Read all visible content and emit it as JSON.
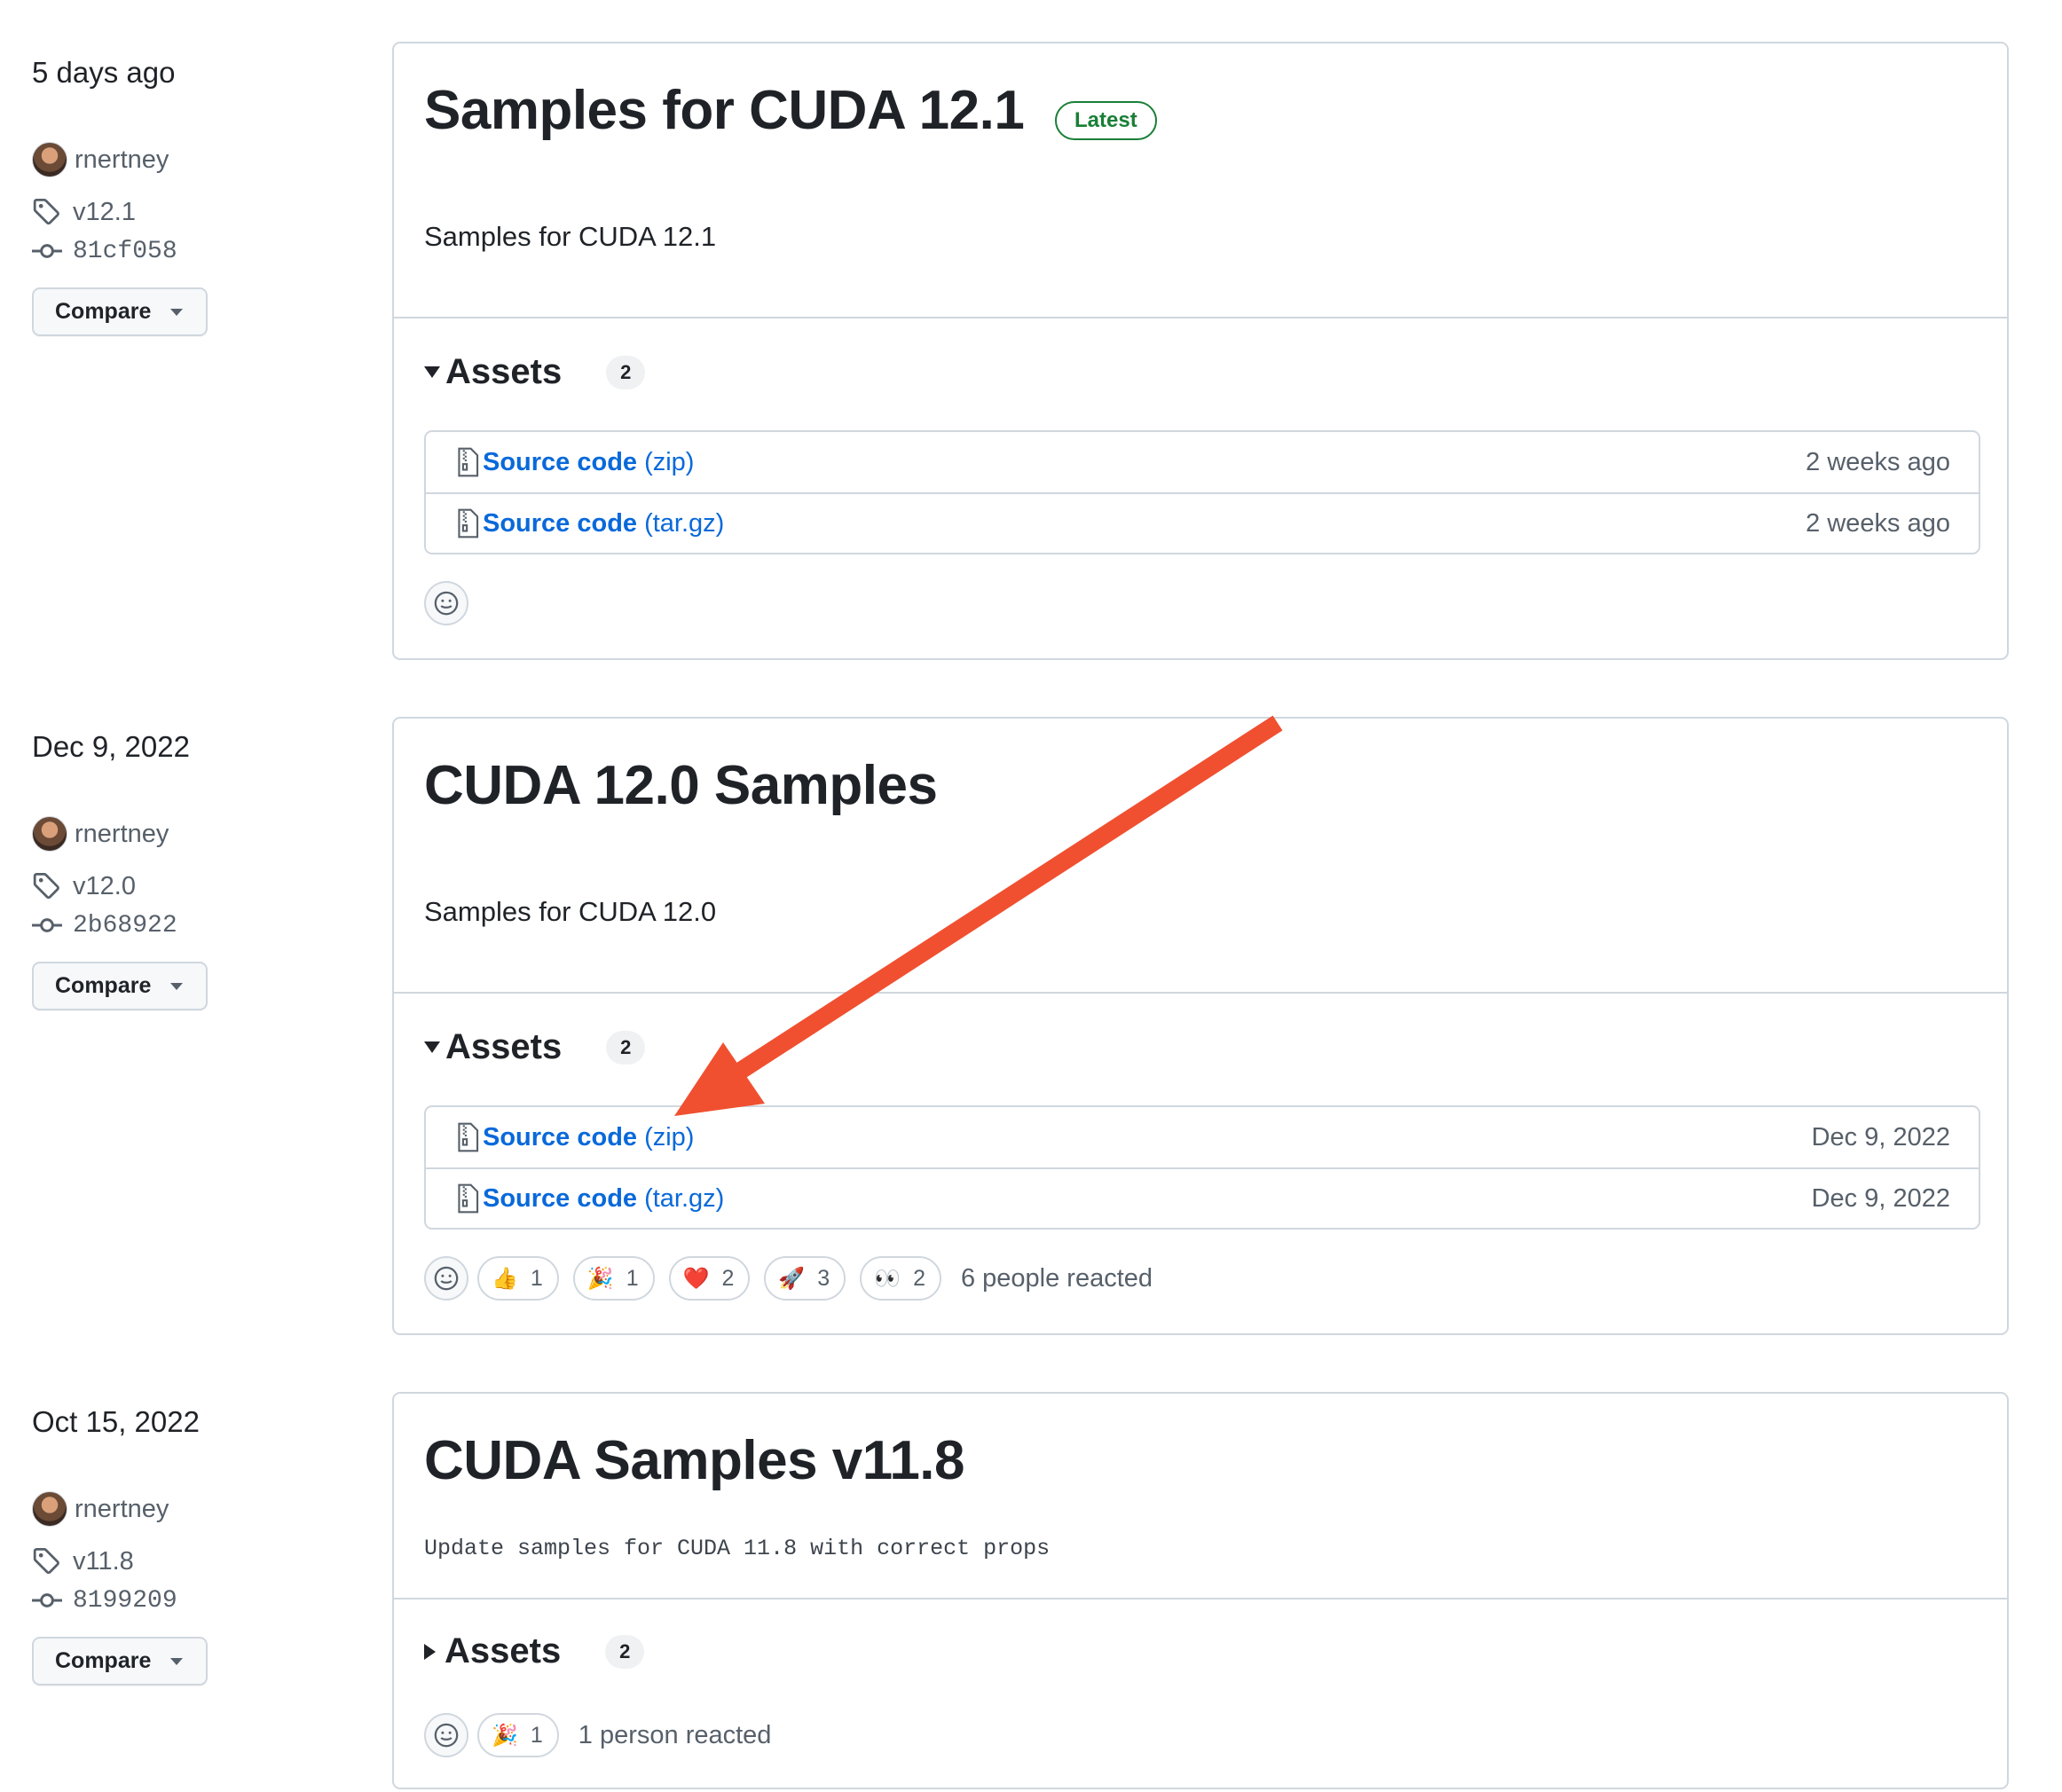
{
  "compare_label": "Compare",
  "assets_label": "Assets",
  "colors": {
    "accent": "#0969da",
    "latest_green": "#1a7f37",
    "annotation_arrow": "#f05030",
    "border": "#d0d7de"
  },
  "releases": [
    {
      "date": "5 days ago",
      "author": "rnertney",
      "tag": "v12.1",
      "commit": "81cf058",
      "title": "Samples for CUDA 12.1",
      "badge": "Latest",
      "description": "Samples for CUDA 12.1",
      "assets_count": "2",
      "assets_expanded": true,
      "assets": [
        {
          "name": "Source code",
          "type": "(zip)",
          "date": "2 weeks ago"
        },
        {
          "name": "Source code",
          "type": "(tar.gz)",
          "date": "2 weeks ago"
        }
      ],
      "reactions": [],
      "reacted_text": ""
    },
    {
      "date": "Dec 9, 2022",
      "author": "rnertney",
      "tag": "v12.0",
      "commit": "2b68922",
      "title": "CUDA 12.0 Samples",
      "description": "Samples for CUDA 12.0",
      "assets_count": "2",
      "assets_expanded": true,
      "assets": [
        {
          "name": "Source code",
          "type": "(zip)",
          "date": "Dec 9, 2022"
        },
        {
          "name": "Source code",
          "type": "(tar.gz)",
          "date": "Dec 9, 2022"
        }
      ],
      "reactions": [
        {
          "emoji": "👍",
          "icon": "thumbs-up-icon",
          "count": "1"
        },
        {
          "emoji": "🎉",
          "icon": "tada-icon",
          "count": "1"
        },
        {
          "emoji": "❤️",
          "icon": "heart-icon",
          "count": "2"
        },
        {
          "emoji": "🚀",
          "icon": "rocket-icon",
          "count": "3"
        },
        {
          "emoji": "👀",
          "icon": "eyes-icon",
          "count": "2"
        }
      ],
      "reacted_text": "6 people reacted"
    },
    {
      "date": "Oct 15, 2022",
      "author": "rnertney",
      "tag": "v11.8",
      "commit": "8199209",
      "title": "CUDA Samples v11.8",
      "description": "Update samples for CUDA 11.8 with correct props",
      "assets_count": "2",
      "assets_expanded": false,
      "reactions": [
        {
          "emoji": "🎉",
          "icon": "tada-icon",
          "count": "1"
        }
      ],
      "reacted_text": "1 person reacted"
    }
  ]
}
